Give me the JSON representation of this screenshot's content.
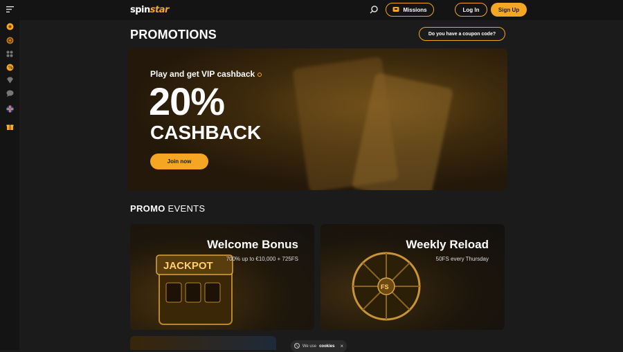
{
  "brand": {
    "logo_part1": "spin",
    "logo_part2": "star"
  },
  "header": {
    "missions_label": "Missions",
    "login_label": "Log In",
    "signup_label": "Sign Up"
  },
  "sidebar": {
    "icons": [
      "menu-icon",
      "casino-icon",
      "sports-icon",
      "games-icon",
      "promotions-icon",
      "vip-icon",
      "chat-icon",
      "uk-flag-icon",
      "gift-icon"
    ]
  },
  "page": {
    "title": "PROMOTIONS",
    "coupon_label": "Do you have a coupon code?"
  },
  "hero": {
    "subtitle": "Play and get VIP cashback",
    "big_value": "20%",
    "headline": "CASHBACK",
    "cta_label": "Join now"
  },
  "section": {
    "title_bold": "PROMO",
    "title_rest": " EVENTS"
  },
  "promos": [
    {
      "title": "Welcome Bonus",
      "description": "700% up to €10,000 + 725FS",
      "art_text": "JACKPOT"
    },
    {
      "title": "Weekly Reload",
      "description": "50FS every Thursday",
      "art_text": "FS"
    }
  ],
  "cookie": {
    "prefix": "We use",
    "bold": "cookies",
    "close": "×"
  },
  "colors": {
    "accent": "#f5a623",
    "background": "#1b1b1b",
    "topbar": "#141414"
  }
}
